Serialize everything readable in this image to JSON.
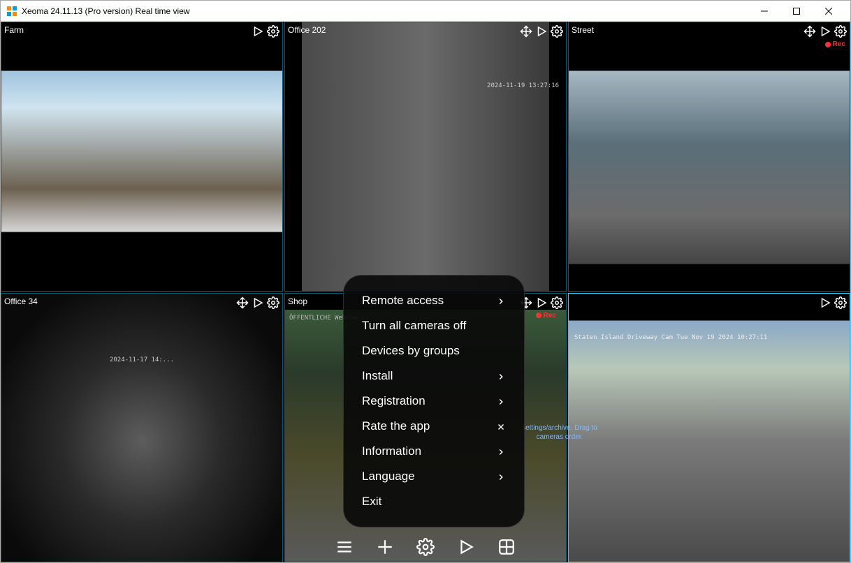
{
  "window": {
    "title": "Xeoma 24.11.13 (Pro version) Real time view"
  },
  "cameras": [
    {
      "label": "Farm",
      "rec": false,
      "timestamp": ""
    },
    {
      "label": "Office 202",
      "rec": false,
      "timestamp": "2024-11-19 13:27:16"
    },
    {
      "label": "Street",
      "rec": true,
      "rec_label": "Rec",
      "timestamp": ""
    },
    {
      "label": "Office 34",
      "rec": false,
      "timestamp": "2024-11-17 14:..."
    },
    {
      "label": "Shop",
      "rec": true,
      "rec_label": "Rec",
      "overlay_text": "ÖFFENTLICHE Webcam"
    },
    {
      "label": "",
      "rec": false,
      "overlay_text": "Staten Island Driveway Cam Tue Nov 19 2024 10:27:11"
    }
  ],
  "hint": {
    "line1": "settings/archive. Drag to",
    "line2": "cameras order."
  },
  "menu": {
    "items": [
      {
        "label": "Remote access",
        "arrow": true,
        "close": false
      },
      {
        "label": "Turn all cameras off",
        "arrow": false,
        "close": false
      },
      {
        "label": "Devices by groups",
        "arrow": false,
        "close": false
      },
      {
        "label": "Install",
        "arrow": true,
        "close": false
      },
      {
        "label": "Registration",
        "arrow": true,
        "close": false
      },
      {
        "label": "Rate the app",
        "arrow": false,
        "close": true
      },
      {
        "label": "Information",
        "arrow": true,
        "close": false
      },
      {
        "label": "Language",
        "arrow": true,
        "close": false
      },
      {
        "label": "Exit",
        "arrow": false,
        "close": false
      }
    ]
  },
  "icons": {
    "move": "move-icon",
    "play": "play-icon",
    "gear": "gear-icon"
  }
}
